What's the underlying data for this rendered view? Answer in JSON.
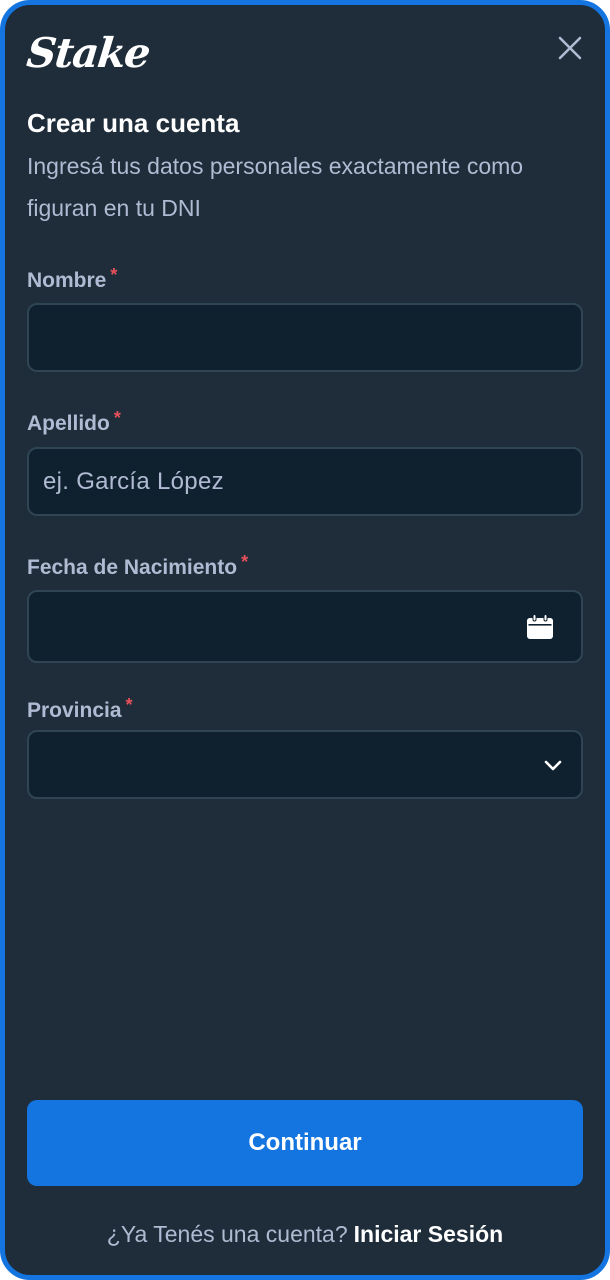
{
  "brand": {
    "logo_text": "Stake"
  },
  "header": {
    "title": "Crear una cuenta",
    "subtitle": "Ingresá tus datos personales exactamente como figuran en tu DNI"
  },
  "form": {
    "required_marker": "*",
    "first_name": {
      "label": "Nombre",
      "value": "",
      "placeholder": ""
    },
    "last_name": {
      "label": "Apellido",
      "value": "",
      "placeholder": "ej. García López"
    },
    "birth_date": {
      "label": "Fecha de Nacimiento",
      "value": "",
      "icon": "calendar-icon"
    },
    "province": {
      "label": "Provincia",
      "selected": "",
      "icon": "chevron-down-icon"
    }
  },
  "actions": {
    "continue_label": "Continuar",
    "close_icon": "close-icon"
  },
  "footer": {
    "prompt": "¿Ya Tenés una cuenta?",
    "login_link": "Iniciar Sesión"
  },
  "colors": {
    "accent": "#1475e1",
    "background": "#1e2d39",
    "input_bg": "#0f212e",
    "input_border": "#2f4553",
    "muted_text": "#b1bad3",
    "required": "#e8505b"
  }
}
